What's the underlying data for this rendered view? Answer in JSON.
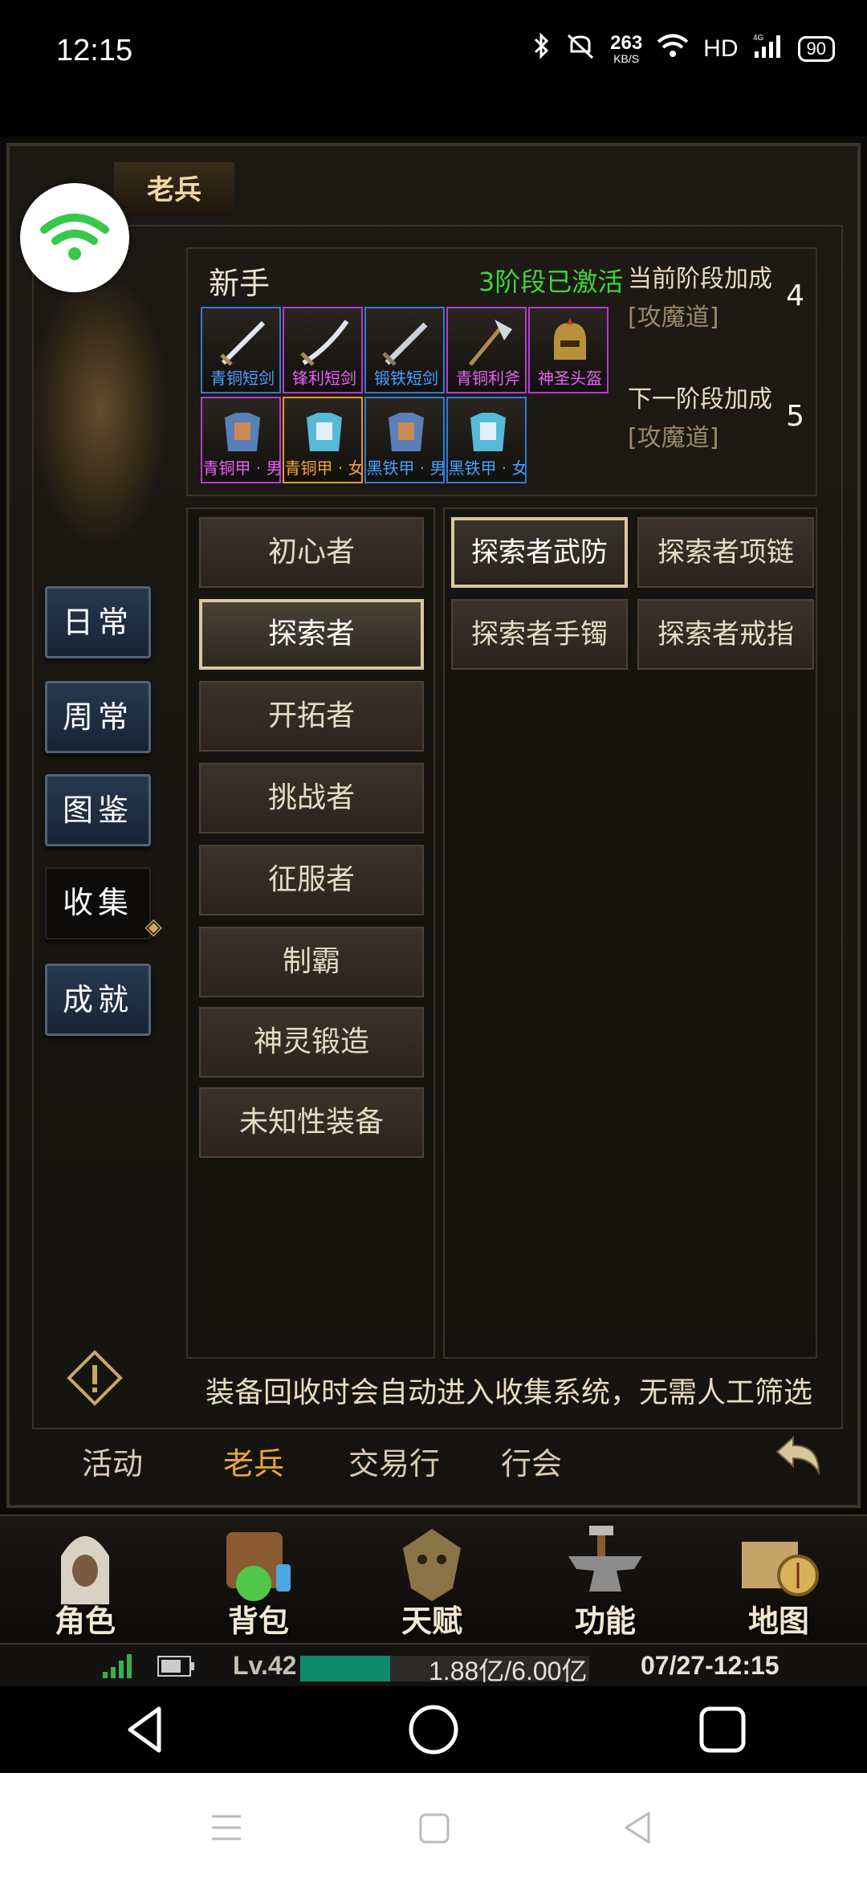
{
  "status_bar": {
    "time": "12:15",
    "speed_value": "263",
    "speed_unit": "KB/S",
    "network": "HD",
    "network_gen": "4G",
    "battery": "90"
  },
  "panel": {
    "title": "老兵"
  },
  "side_menu": [
    {
      "label": "日常",
      "active": false
    },
    {
      "label": "周常",
      "active": false
    },
    {
      "label": "图鉴",
      "active": false
    },
    {
      "label": "收集",
      "active": true
    },
    {
      "label": "成就",
      "active": false
    }
  ],
  "summary": {
    "title": "新手",
    "status": "3阶段已激活",
    "current_bonus_label": "当前阶段加成",
    "current_bonus_stat": "[攻魔道]",
    "current_bonus_value": "4",
    "next_bonus_label": "下一阶段加成",
    "next_bonus_stat": "[攻魔道]",
    "next_bonus_value": "5",
    "items": [
      {
        "label": "青铜短剑",
        "quality": "blue",
        "icon": "sword-icon"
      },
      {
        "label": "锋利短剑",
        "quality": "purple",
        "icon": "sword-icon"
      },
      {
        "label": "锻铁短剑",
        "quality": "blue",
        "icon": "sword-icon"
      },
      {
        "label": "青铜利斧",
        "quality": "purple",
        "icon": "axe-icon"
      },
      {
        "label": "神圣头盔",
        "quality": "purple",
        "icon": "helmet-icon"
      },
      {
        "label": "青铜甲 · 男",
        "quality": "purple",
        "icon": "armor-icon"
      },
      {
        "label": "青铜甲 · 女",
        "quality": "orange",
        "icon": "armor-icon"
      },
      {
        "label": "黑铁甲 · 男",
        "quality": "blue",
        "icon": "armor-icon"
      },
      {
        "label": "黑铁甲 · 女",
        "quality": "blue",
        "icon": "armor-icon"
      }
    ]
  },
  "categories": [
    {
      "label": "初心者",
      "selected": false
    },
    {
      "label": "探索者",
      "selected": true
    },
    {
      "label": "开拓者",
      "selected": false
    },
    {
      "label": "挑战者",
      "selected": false
    },
    {
      "label": "征服者",
      "selected": false
    },
    {
      "label": "制霸",
      "selected": false
    },
    {
      "label": "神灵锻造",
      "selected": false
    },
    {
      "label": "未知性装备",
      "selected": false
    }
  ],
  "subcategories": [
    {
      "label": "探索者武防",
      "selected": true
    },
    {
      "label": "探索者项链",
      "selected": false
    },
    {
      "label": "探索者手镯",
      "selected": false
    },
    {
      "label": "探索者戒指",
      "selected": false
    }
  ],
  "tip": "装备回收时会自动进入收集系统，无需人工筛选",
  "bottom_tabs": [
    {
      "label": "活动",
      "active": false
    },
    {
      "label": "老兵",
      "active": true
    },
    {
      "label": "交易行",
      "active": false
    },
    {
      "label": "行会",
      "active": false
    }
  ],
  "main_menu": [
    {
      "label": "角色",
      "icon": "character-icon"
    },
    {
      "label": "背包",
      "icon": "backpack-icon"
    },
    {
      "label": "天赋",
      "icon": "talent-icon"
    },
    {
      "label": "功能",
      "icon": "anvil-icon"
    },
    {
      "label": "地图",
      "icon": "map-icon"
    }
  ],
  "info_bar": {
    "level": "Lv.42",
    "exp_text": "1.88亿/6.00亿",
    "exp_fraction": 0.31,
    "time": "07/27-12:15"
  },
  "colors": {
    "quality_blue": "#2f7bd6",
    "quality_purple": "#b73bd0",
    "quality_orange": "#e39b2a",
    "active_text_green": "#3dd63d",
    "active_tab_gold": "#e4a93a"
  }
}
